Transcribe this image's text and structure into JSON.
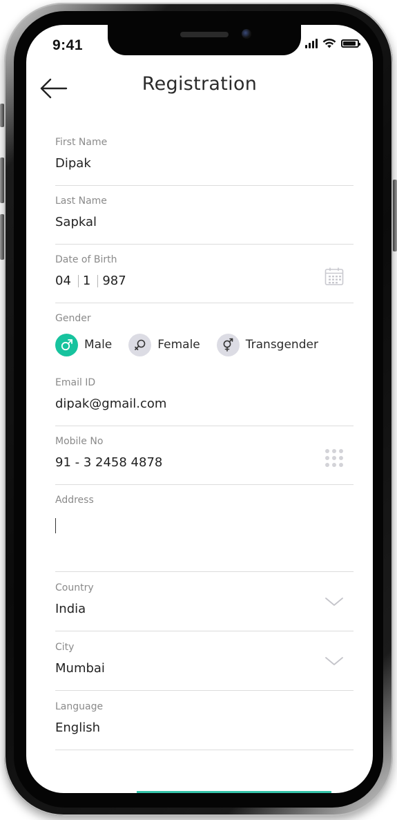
{
  "status_bar": {
    "time": "9:41"
  },
  "header": {
    "title": "Registration"
  },
  "form": {
    "first_name": {
      "label": "First Name",
      "value": "Dipak"
    },
    "last_name": {
      "label": "Last Name",
      "value": "Sapkal"
    },
    "dob": {
      "label": "Date of Birth",
      "day": "04",
      "month": "1",
      "year": "987"
    },
    "gender": {
      "label": "Gender",
      "options": [
        "Male",
        "Female",
        "Transgender"
      ],
      "selected": "Male"
    },
    "email": {
      "label": "Email ID",
      "value": "dipak@gmail.com"
    },
    "mobile": {
      "label": "Mobile No",
      "value": "91 - 3 2458 4878"
    },
    "address": {
      "label": "Address",
      "value": ""
    },
    "country": {
      "label": "Country",
      "value": "India"
    },
    "city": {
      "label": "City",
      "value": "Mumbai"
    },
    "language": {
      "label": "Language",
      "value": "English"
    }
  },
  "colors": {
    "accent": "#17c39e",
    "divider": "#dcdcdc",
    "label": "#8a8a8a"
  }
}
